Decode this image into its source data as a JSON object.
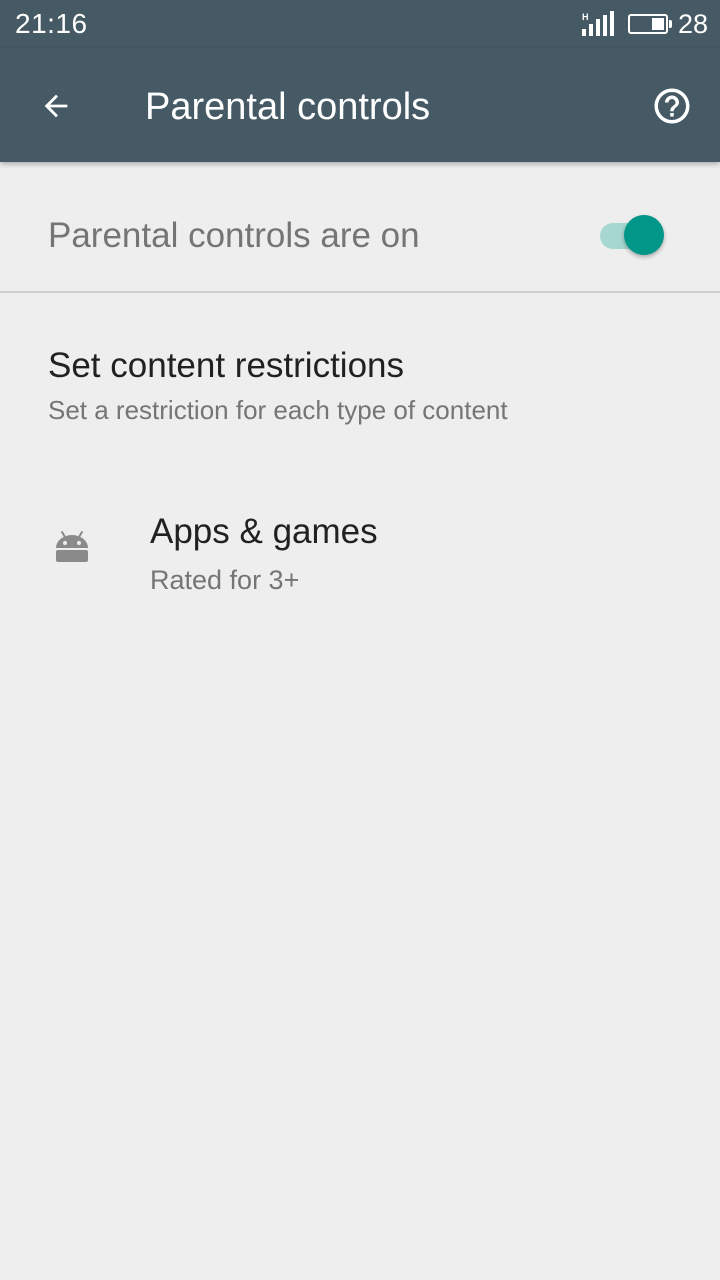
{
  "status_bar": {
    "time": "21:16",
    "network_type": "H",
    "battery_level": "28"
  },
  "app_bar": {
    "title": "Parental controls",
    "back_icon": "arrow-back-icon",
    "help_icon": "help-circle-icon"
  },
  "master_toggle": {
    "label": "Parental controls are on",
    "on": true,
    "accent_color": "#009688"
  },
  "content_restrictions": {
    "title": "Set content restrictions",
    "subtitle": "Set a restriction for each type of content"
  },
  "categories": [
    {
      "icon": "android-icon",
      "title": "Apps & games",
      "rating": "Rated for 3+"
    }
  ],
  "colors": {
    "app_bar": "#455a64",
    "background": "#eeeeee"
  }
}
